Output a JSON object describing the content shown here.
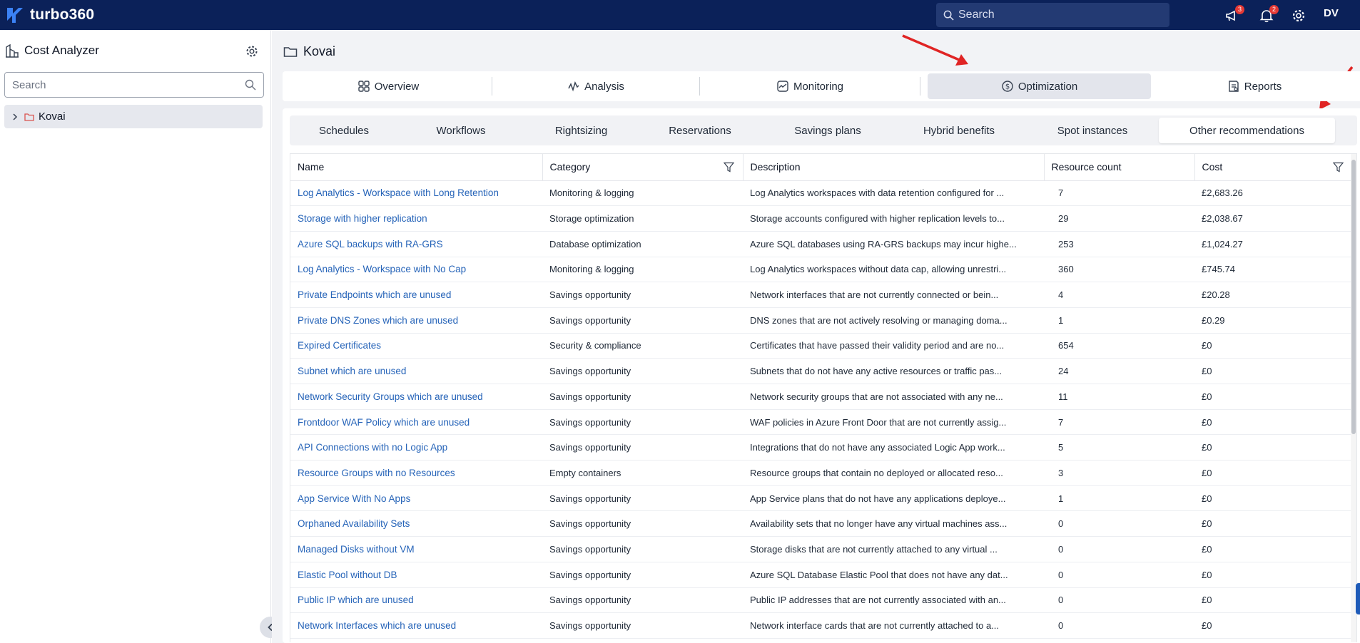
{
  "app": {
    "brand": "turbo360",
    "search_placeholder": "Search",
    "notifications_count": "3",
    "alerts_count": "2",
    "user_initials": "DV"
  },
  "sidebar": {
    "title": "Cost Analyzer",
    "search_placeholder": "Search",
    "tree": [
      {
        "label": "Kovai"
      }
    ]
  },
  "main": {
    "title": "Kovai",
    "tabs": [
      {
        "label": "Overview",
        "icon": "overview-icon"
      },
      {
        "label": "Analysis",
        "icon": "analysis-icon"
      },
      {
        "label": "Monitoring",
        "icon": "monitoring-icon"
      },
      {
        "label": "Optimization",
        "icon": "optimization-icon",
        "active": true
      },
      {
        "label": "Reports",
        "icon": "reports-icon"
      }
    ],
    "subtabs": [
      {
        "label": "Schedules"
      },
      {
        "label": "Workflows"
      },
      {
        "label": "Rightsizing"
      },
      {
        "label": "Reservations"
      },
      {
        "label": "Savings plans"
      },
      {
        "label": "Hybrid benefits"
      },
      {
        "label": "Spot instances"
      },
      {
        "label": "Other recommendations",
        "active": true
      }
    ]
  },
  "table": {
    "columns": [
      "Name",
      "Category",
      "Description",
      "Resource count",
      "Cost"
    ],
    "rows": [
      [
        "Log Analytics - Workspace with Long Retention",
        "Monitoring & logging",
        "Log Analytics workspaces with data retention configured for ...",
        "7",
        "£2,683.26"
      ],
      [
        "Storage with higher replication",
        "Storage optimization",
        "Storage accounts configured with higher replication levels to...",
        "29",
        "£2,038.67"
      ],
      [
        "Azure SQL backups with RA-GRS",
        "Database optimization",
        "Azure SQL databases using RA-GRS backups may incur highe...",
        "253",
        "£1,024.27"
      ],
      [
        "Log Analytics - Workspace with No Cap",
        "Monitoring & logging",
        "Log Analytics workspaces without data cap, allowing unrestri...",
        "360",
        "£745.74"
      ],
      [
        "Private Endpoints which are unused",
        "Savings opportunity",
        "Network interfaces that are not currently connected or bein...",
        "4",
        "£20.28"
      ],
      [
        "Private DNS Zones which are unused",
        "Savings opportunity",
        "DNS zones that are not actively resolving or managing doma...",
        "1",
        "£0.29"
      ],
      [
        "Expired Certificates",
        "Security & compliance",
        "Certificates that have passed their validity period and are no...",
        "654",
        "£0"
      ],
      [
        "Subnet which are unused",
        "Savings opportunity",
        "Subnets that do not have any active resources or traffic pas...",
        "24",
        "£0"
      ],
      [
        "Network Security Groups which are unused",
        "Savings opportunity",
        "Network security groups that are not associated with any ne...",
        "11",
        "£0"
      ],
      [
        "Frontdoor WAF Policy which are unused",
        "Savings opportunity",
        "WAF policies in Azure Front Door that are not currently assig...",
        "7",
        "£0"
      ],
      [
        "API Connections with no Logic App",
        "Savings opportunity",
        "Integrations that do not have any associated Logic App work...",
        "5",
        "£0"
      ],
      [
        "Resource Groups with no Resources",
        "Empty containers",
        "Resource groups that contain no deployed or allocated reso...",
        "3",
        "£0"
      ],
      [
        "App Service With No Apps",
        "Savings opportunity",
        "App Service plans that do not have any applications deploye...",
        "1",
        "£0"
      ],
      [
        "Orphaned Availability Sets",
        "Savings opportunity",
        "Availability sets that no longer have any virtual machines ass...",
        "0",
        "£0"
      ],
      [
        "Managed Disks without VM",
        "Savings opportunity",
        "Storage disks that are not currently attached to any virtual ...",
        "0",
        "£0"
      ],
      [
        "Elastic Pool without DB",
        "Savings opportunity",
        "Azure SQL Database Elastic Pool that does not have any dat...",
        "0",
        "£0"
      ],
      [
        "Public IP which are unused",
        "Savings opportunity",
        "Public IP addresses that are not currently associated with an...",
        "0",
        "£0"
      ],
      [
        "Network Interfaces which are unused",
        "Savings opportunity",
        "Network interface cards that are not currently attached to a...",
        "0",
        "£0"
      ]
    ]
  },
  "colors": {
    "topbar": "#0b2159",
    "link": "#2563b8",
    "annotation_arrow": "#e02424"
  }
}
